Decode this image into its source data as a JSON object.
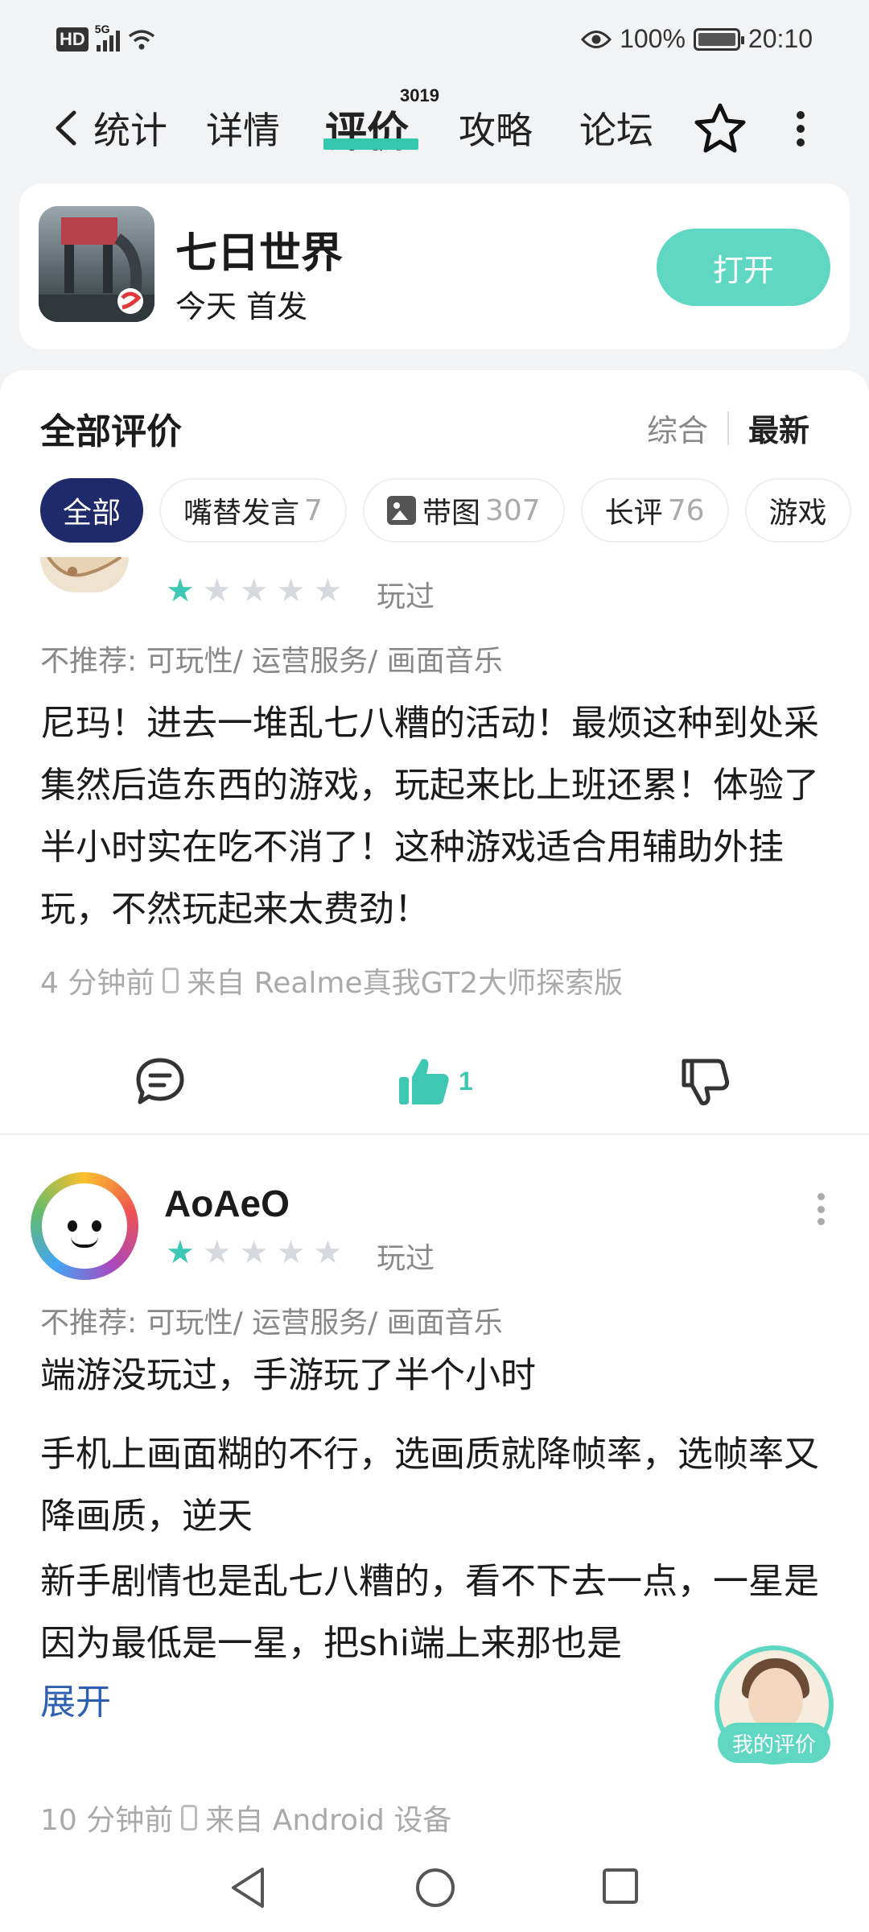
{
  "status_bar": {
    "hd": "HD",
    "network": "5G",
    "battery": "100%",
    "time": "20:10",
    "icons": [
      "signal-icon",
      "wifi-icon",
      "eye-icon",
      "battery-saver-icon"
    ]
  },
  "nav": {
    "tabs": [
      {
        "label": "统计"
      },
      {
        "label": "详情"
      },
      {
        "label": "评价",
        "badge": "3019",
        "active": true
      },
      {
        "label": "攻略"
      },
      {
        "label": "论坛"
      }
    ],
    "accent": "#36c7b0"
  },
  "app": {
    "name": "七日世界",
    "subtitle": "今天 首发",
    "open_label": "打开"
  },
  "reviews_header": {
    "title": "全部评价",
    "sort_options": [
      "综合",
      "最新"
    ],
    "selected_sort": "最新"
  },
  "filters": [
    {
      "label": "全部",
      "count": ""
    },
    {
      "label": "嘴替发言",
      "count": "7"
    },
    {
      "label": "带图",
      "count": "307"
    },
    {
      "label": "长评",
      "count": "76"
    },
    {
      "label": "游戏",
      "count": ""
    }
  ],
  "reviews": [
    {
      "rating": 1,
      "status": "玩过",
      "tags": "不推荐: 可玩性/ 运营服务/ 画面音乐",
      "text": "尼玛！进去一堆乱七八糟的活动！最烦这种到处采集然后造东西的游戏，玩起来比上班还累！体验了半小时实在吃不消了！这种游戏适合用辅助外挂玩，不然玩起来太费劲！",
      "time": "4 分钟前",
      "device": "来自 Realme真我GT2大师探索版",
      "likes": "1"
    },
    {
      "username": "AoAeO",
      "rating": 1,
      "status": "玩过",
      "tags": "不推荐: 可玩性/ 运营服务/ 画面音乐",
      "paragraphs": [
        "端游没玩过，手游玩了半个小时",
        "手机上画面糊的不行，选画质就降帧率，选帧率又降画质，逆天",
        "新手剧情也是乱七八糟的，看不下去一点，一星是因为最低是一星，把shi端上来那也是"
      ],
      "expand_label": "展开",
      "time": "10 分钟前",
      "device": "来自 Android 设备"
    }
  ],
  "floating": {
    "label": "我的评价"
  }
}
